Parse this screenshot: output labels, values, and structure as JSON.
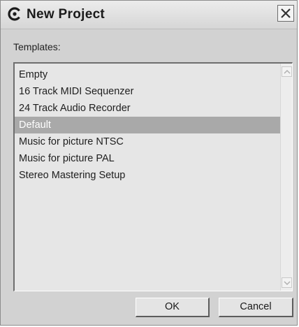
{
  "window": {
    "title": "New Project"
  },
  "templates": {
    "label": "Templates:",
    "items": [
      "Empty",
      "16 Track MIDI Sequenzer",
      "24 Track Audio Recorder",
      "Default",
      "Music for picture NTSC",
      "Music for picture PAL",
      "Stereo Mastering Setup"
    ],
    "selected": "Default"
  },
  "buttons": {
    "ok": "OK",
    "cancel": "Cancel"
  },
  "icons": {
    "app": "cubase-logo-icon",
    "close": "close-icon",
    "scroll_up": "chevron-up-icon",
    "scroll_down": "chevron-down-icon"
  },
  "colors": {
    "dialog_bg": "#d2d2d2",
    "list_bg": "#e6e6e6",
    "selection_bg": "#a9a9a9",
    "selection_text": "#ffffff"
  }
}
